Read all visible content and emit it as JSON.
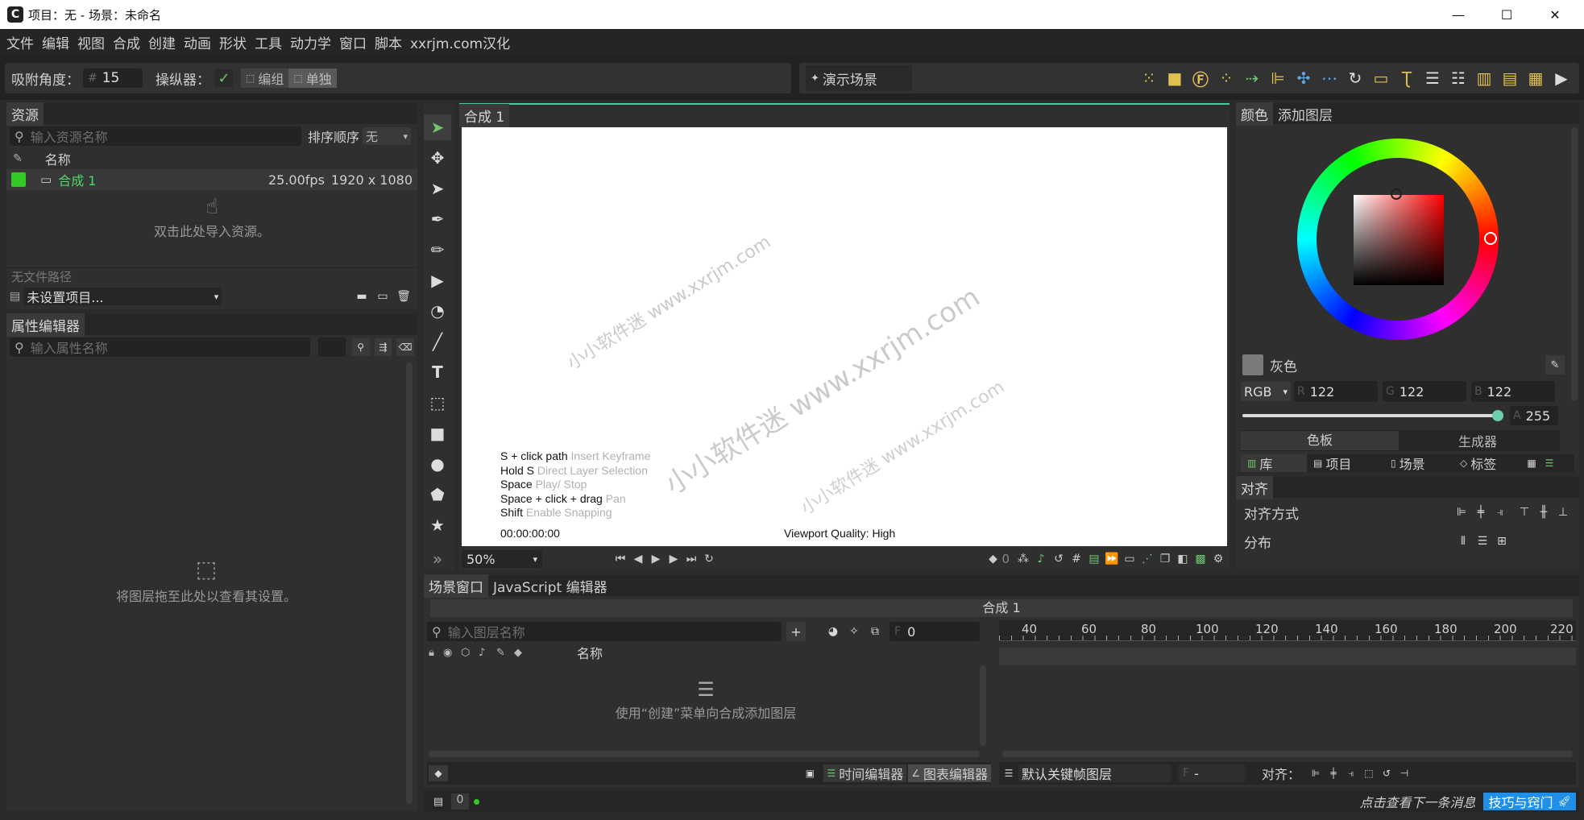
{
  "window": {
    "title": "项目：无 - 场景：未命名",
    "minimize": "—",
    "maximize": "☐",
    "close": "✕"
  },
  "menu": [
    "文件",
    "编辑",
    "视图",
    "合成",
    "创建",
    "动画",
    "形状",
    "工具",
    "动力学",
    "窗口",
    "脚本",
    "xxrjm.com汉化"
  ],
  "toolbar": {
    "snap_label": "吸附角度：",
    "snap_hash": "#",
    "snap_value": "15",
    "manip_label": "操纵器：",
    "group": "编组",
    "single": "单独",
    "demo": "演示场景"
  },
  "assets": {
    "tab": "资源",
    "search_placeholder": "输入资源名称",
    "sort_label": "排序顺序",
    "sort_value": "无",
    "col_name": "名称",
    "item_name": "合成 1",
    "item_fps": "25.00fps",
    "item_res": "1920 x 1080",
    "hint": "双击此处导入资源。",
    "no_path": "无文件路径",
    "project_select": "未设置项目..."
  },
  "props": {
    "tab": "属性编辑器",
    "search_placeholder": "输入属性名称",
    "hint": "将图层拖至此处以查看其设置。"
  },
  "viewport": {
    "tab": "合成 1",
    "help": [
      {
        "k": "S + click path",
        "v": "Insert Keyframe"
      },
      {
        "k": "Hold S",
        "v": "Direct Layer Selection"
      },
      {
        "k": "Space",
        "v": "Play/ Stop"
      },
      {
        "k": "Space + click + drag",
        "v": "Pan"
      },
      {
        "k": "Shift",
        "v": "Enable Snapping"
      }
    ],
    "timecode": "00:00:00:00",
    "quality": "Viewport Quality: High",
    "zoom": "50%",
    "frame": "0"
  },
  "watermark": [
    "小小软件迷 www.xxrjm.com",
    "小小软件迷 www.xxrjm.com",
    "小小软件迷 www.xxrjm.com"
  ],
  "color": {
    "tab1": "颜色",
    "tab2": "添加图层",
    "name": "灰色",
    "mode": "RGB",
    "r_label": "R",
    "r": "122",
    "g_label": "G",
    "g": "122",
    "b_label": "B",
    "b": "122",
    "a_label": "A",
    "a": "255",
    "alpha": 1.0,
    "swatch": "#7a7a7a",
    "palette": "色板",
    "generator": "生成器"
  },
  "library_tabs": [
    "库",
    "项目",
    "场景",
    "标签"
  ],
  "align": {
    "tab": "对齐",
    "method": "对齐方式",
    "distribute": "分布"
  },
  "scene": {
    "tab1": "场景窗口",
    "tab2": "JavaScript 编辑器",
    "comp": "合成 1",
    "search_placeholder": "输入图层名称",
    "frame_label": "F",
    "frame_value": "0",
    "col_name": "名称",
    "hint": "使用“创建”菜单向合成添加图层",
    "timeline_btn": "时间编辑器",
    "graph_btn": "图表编辑器",
    "keyframe_layer": "默认关键帧图层",
    "kf_label": "F",
    "kf_value": "-",
    "align_label": "对齐：",
    "ruler": [
      "40",
      "60",
      "80",
      "100",
      "120",
      "140",
      "160",
      "180",
      "200",
      "220"
    ]
  },
  "status": {
    "count": "0",
    "tip": "点击查看下一条消息",
    "tips_btn": "技巧与窍门"
  }
}
